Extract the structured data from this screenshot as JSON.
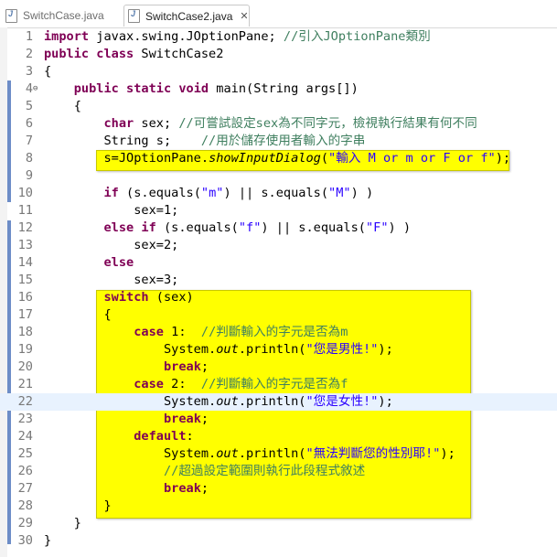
{
  "tabs": [
    {
      "label": "SwitchCase.java",
      "active": false
    },
    {
      "label": "SwitchCase2.java",
      "active": true,
      "close": "✕"
    }
  ],
  "editor": {
    "lines": [
      {
        "n": "1",
        "tokens": [
          {
            "t": "import",
            "c": "kw"
          },
          {
            "t": " javax.swing.JOptionPane; "
          },
          {
            "t": "//引入JOptionPane類別",
            "c": "cm"
          }
        ]
      },
      {
        "n": "2",
        "tokens": [
          {
            "t": "public",
            "c": "kw"
          },
          {
            "t": " "
          },
          {
            "t": "class",
            "c": "kw"
          },
          {
            "t": " SwitchCase2"
          }
        ]
      },
      {
        "n": "3",
        "tokens": [
          {
            "t": "{"
          }
        ]
      },
      {
        "n": "4",
        "fold": "⊖",
        "tokens": [
          {
            "t": "    "
          },
          {
            "t": "public",
            "c": "kw"
          },
          {
            "t": " "
          },
          {
            "t": "static",
            "c": "kw"
          },
          {
            "t": " "
          },
          {
            "t": "void",
            "c": "kw"
          },
          {
            "t": " main(String args[])"
          }
        ]
      },
      {
        "n": "5",
        "tokens": [
          {
            "t": "    {"
          }
        ]
      },
      {
        "n": "6",
        "tokens": [
          {
            "t": "        "
          },
          {
            "t": "char",
            "c": "kw"
          },
          {
            "t": " sex; "
          },
          {
            "t": "//可嘗試設定sex為不同字元，檢視執行結果有何不同",
            "c": "cm"
          }
        ]
      },
      {
        "n": "7",
        "tokens": [
          {
            "t": "        String s;    "
          },
          {
            "t": "//用於儲存使用者輸入的字串",
            "c": "cm"
          }
        ]
      },
      {
        "n": "8",
        "tokens": [
          {
            "t": "        s=JOptionPane."
          },
          {
            "t": "showInputDialog",
            "c": "it"
          },
          {
            "t": "("
          },
          {
            "t": "\"輸入 M or m or F or f\"",
            "c": "st"
          },
          {
            "t": ");"
          }
        ]
      },
      {
        "n": "9",
        "tokens": []
      },
      {
        "n": "10",
        "tokens": [
          {
            "t": "        "
          },
          {
            "t": "if",
            "c": "kw"
          },
          {
            "t": " (s.equals("
          },
          {
            "t": "\"m\"",
            "c": "st"
          },
          {
            "t": ") || s.equals("
          },
          {
            "t": "\"M\"",
            "c": "st"
          },
          {
            "t": ") )"
          }
        ]
      },
      {
        "n": "11",
        "tokens": [
          {
            "t": "            sex=1;"
          }
        ]
      },
      {
        "n": "12",
        "tokens": [
          {
            "t": "        "
          },
          {
            "t": "else",
            "c": "kw"
          },
          {
            "t": " "
          },
          {
            "t": "if",
            "c": "kw"
          },
          {
            "t": " (s.equals("
          },
          {
            "t": "\"f\"",
            "c": "st"
          },
          {
            "t": ") || s.equals("
          },
          {
            "t": "\"F\"",
            "c": "st"
          },
          {
            "t": ") )"
          }
        ]
      },
      {
        "n": "13",
        "tokens": [
          {
            "t": "            sex=2;"
          }
        ]
      },
      {
        "n": "14",
        "tokens": [
          {
            "t": "        "
          },
          {
            "t": "else",
            "c": "kw"
          }
        ]
      },
      {
        "n": "15",
        "tokens": [
          {
            "t": "            sex=3;"
          }
        ]
      },
      {
        "n": "16",
        "tokens": [
          {
            "t": "        "
          },
          {
            "t": "switch",
            "c": "kw"
          },
          {
            "t": " (sex)"
          }
        ]
      },
      {
        "n": "17",
        "tokens": [
          {
            "t": "        {"
          }
        ]
      },
      {
        "n": "18",
        "tokens": [
          {
            "t": "            "
          },
          {
            "t": "case",
            "c": "kw"
          },
          {
            "t": " 1:  "
          },
          {
            "t": "//判斷輸入的字元是否為m",
            "c": "cm"
          }
        ]
      },
      {
        "n": "19",
        "tokens": [
          {
            "t": "                System."
          },
          {
            "t": "out",
            "c": "it"
          },
          {
            "t": ".println("
          },
          {
            "t": "\"您是男性!\"",
            "c": "st"
          },
          {
            "t": ");"
          }
        ]
      },
      {
        "n": "20",
        "tokens": [
          {
            "t": "                "
          },
          {
            "t": "break",
            "c": "kw"
          },
          {
            "t": ";"
          }
        ]
      },
      {
        "n": "21",
        "tokens": [
          {
            "t": "            "
          },
          {
            "t": "case",
            "c": "kw"
          },
          {
            "t": " 2:  "
          },
          {
            "t": "//判斷輸入的字元是否為f",
            "c": "cm"
          }
        ]
      },
      {
        "n": "22",
        "current": true,
        "tokens": [
          {
            "t": "                System."
          },
          {
            "t": "out",
            "c": "it"
          },
          {
            "t": ".println("
          },
          {
            "t": "\"您是女性!\"",
            "c": "st"
          },
          {
            "t": ");"
          }
        ]
      },
      {
        "n": "23",
        "tokens": [
          {
            "t": "                "
          },
          {
            "t": "break",
            "c": "kw"
          },
          {
            "t": ";"
          }
        ]
      },
      {
        "n": "24",
        "tokens": [
          {
            "t": "            "
          },
          {
            "t": "default",
            "c": "kw"
          },
          {
            "t": ":"
          }
        ]
      },
      {
        "n": "25",
        "tokens": [
          {
            "t": "                System."
          },
          {
            "t": "out",
            "c": "it"
          },
          {
            "t": ".println("
          },
          {
            "t": "\"無法判斷您的性別耶!\"",
            "c": "st"
          },
          {
            "t": ");"
          }
        ]
      },
      {
        "n": "26",
        "tokens": [
          {
            "t": "                "
          },
          {
            "t": "//超過設定範圍則執行此段程式敘述",
            "c": "cm"
          }
        ]
      },
      {
        "n": "27",
        "tokens": [
          {
            "t": "                "
          },
          {
            "t": "break",
            "c": "kw"
          },
          {
            "t": ";"
          }
        ]
      },
      {
        "n": "28",
        "tokens": [
          {
            "t": "        }"
          }
        ]
      },
      {
        "n": "29",
        "tokens": [
          {
            "t": "    }"
          }
        ]
      },
      {
        "n": "30",
        "tokens": [
          {
            "t": "}"
          }
        ]
      }
    ]
  },
  "colors": {
    "keyword": "#7f0055",
    "comment": "#3f7f5f",
    "string": "#2a00ff",
    "highlight": "#ffff00",
    "current_line": "#e8f2fe"
  }
}
